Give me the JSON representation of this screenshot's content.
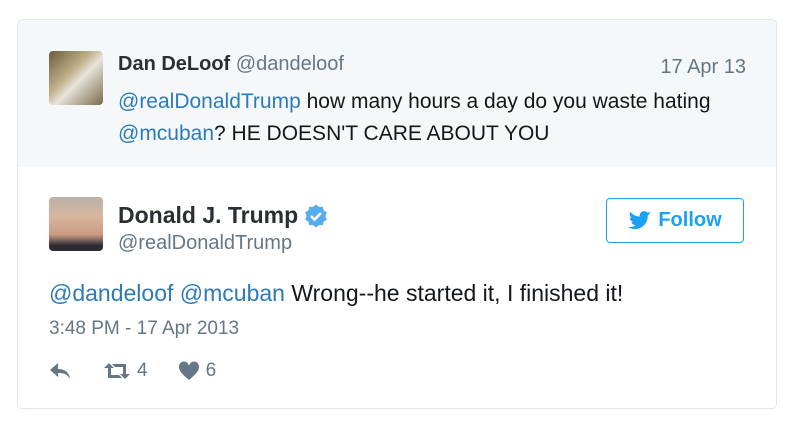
{
  "quoted": {
    "name": "Dan DeLoof",
    "handle": "@dandeloof",
    "date": "17 Apr 13",
    "mention1": "@realDonaldTrump",
    "text1": " how many hours a day do you waste hating ",
    "mention2": "@mcuban",
    "text2": "? HE DOESN'T CARE ABOUT YOU"
  },
  "tweet": {
    "name": "Donald J. Trump",
    "handle": "@realDonaldTrump",
    "follow_label": "Follow",
    "mention1": "@dandeloof",
    "mention2": "@mcuban",
    "text": " Wrong--he started it, I finished it!",
    "timestamp": "3:48 PM - 17 Apr 2013",
    "retweets": "4",
    "likes": "6"
  },
  "colors": {
    "link": "#2b7bb9",
    "accent": "#1da1f2",
    "muted": "#657786"
  },
  "icons": {
    "verified": "verified-badge-icon",
    "bird": "twitter-bird-icon",
    "reply": "reply-icon",
    "retweet": "retweet-icon",
    "like": "heart-icon"
  }
}
